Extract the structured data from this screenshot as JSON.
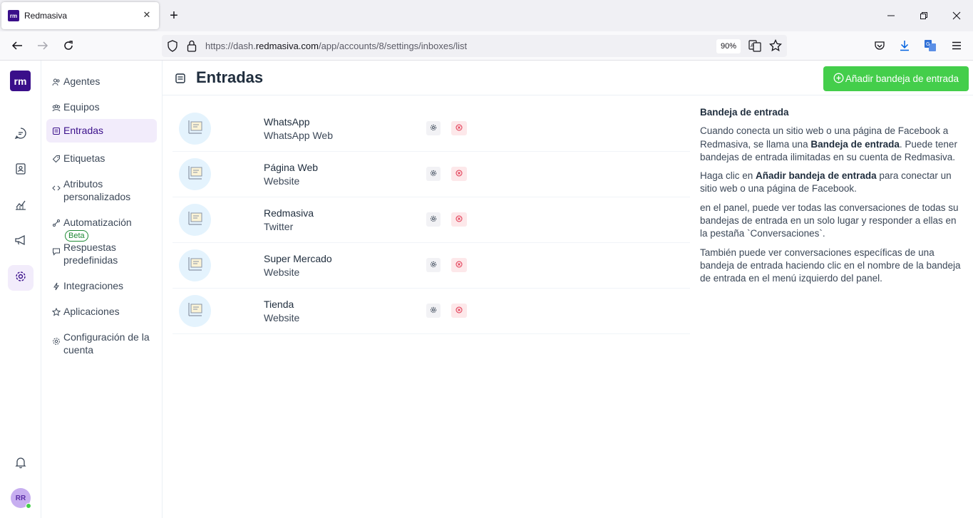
{
  "browser": {
    "tab_title": "Redmasiva",
    "favicon_text": "rm",
    "url_prefix": "https://dash.",
    "url_domain": "redmasiva.com",
    "url_path": "/app/accounts/8/settings/inboxes/list",
    "zoom": "90%"
  },
  "rail": {
    "logo_text": "rm",
    "items": [
      {
        "name": "conversations",
        "icon": "chat-bubble-icon"
      },
      {
        "name": "contacts",
        "icon": "contact-card-icon"
      },
      {
        "name": "reports",
        "icon": "chart-line-icon"
      },
      {
        "name": "campaigns",
        "icon": "megaphone-icon"
      },
      {
        "name": "settings",
        "icon": "gear-icon",
        "active": true
      }
    ],
    "notifications_icon": "bell-icon",
    "avatar_initials": "RR"
  },
  "sidebar": {
    "items": [
      {
        "label": "Agentes",
        "icon": "people-icon"
      },
      {
        "label": "Equipos",
        "icon": "team-icon"
      },
      {
        "label": "Entradas",
        "icon": "inbox-icon",
        "active": true
      },
      {
        "label": "Etiquetas",
        "icon": "tag-icon"
      },
      {
        "label": "Atributos personalizados",
        "icon": "code-icon"
      },
      {
        "label": "Automatización",
        "icon": "automation-icon",
        "badge": "Beta"
      },
      {
        "label": "Respuestas predefinidas",
        "icon": "chat-icon"
      },
      {
        "label": "Integraciones",
        "icon": "flash-icon"
      },
      {
        "label": "Aplicaciones",
        "icon": "star-badge-icon"
      },
      {
        "label": "Configuración de la cuenta",
        "icon": "gear-icon"
      }
    ]
  },
  "header": {
    "title": "Entradas",
    "add_button": "Añadir bandeja de entrada"
  },
  "inboxes": [
    {
      "name": "WhatsApp",
      "type": "WhatsApp Web"
    },
    {
      "name": "Página Web",
      "type": "Website"
    },
    {
      "name": "Redmasiva",
      "type": "Twitter"
    },
    {
      "name": "Super Mercado",
      "type": "Website"
    },
    {
      "name": "Tienda",
      "type": "Website"
    }
  ],
  "help": {
    "title": "Bandeja de entrada",
    "p1_a": "Cuando conecta un sitio web o una página de Facebook a Redmasiva, se llama una ",
    "p1_b": "Bandeja de entrada",
    "p1_c": ". Puede tener bandejas de entrada ilimitadas en su cuenta de Redmasiva.",
    "p2_a": "Haga clic en ",
    "p2_b": "Añadir bandeja de entrada",
    "p2_c": " para conectar un sitio web o una página de Facebook.",
    "p3": "en el panel, puede ver todas las conversaciones de todas su bandejas de entrada en un solo lugar y responder a ellas en la pestaña `Conversaciones`.",
    "p4": "También puede ver conversaciones específicas de una bandeja de entrada haciendo clic en el nombre de la bandeja de entrada en el menú izquierdo del panel."
  },
  "colors": {
    "brand": "#3a0f8a",
    "success": "#44ce4b",
    "danger": "#e0314b"
  }
}
